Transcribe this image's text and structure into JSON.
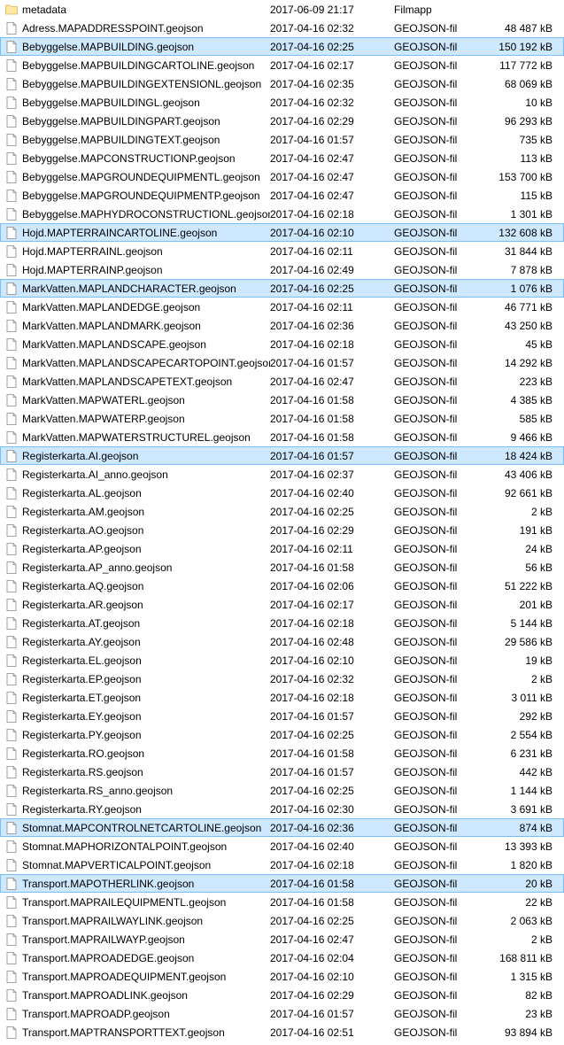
{
  "files": [
    {
      "name": "metadata",
      "date": "2017-06-09 21:17",
      "type": "Filmapp",
      "size": "",
      "icon": "folder",
      "selected": false
    },
    {
      "name": "Adress.MAPADDRESSPOINT.geojson",
      "date": "2017-04-16 02:32",
      "type": "GEOJSON-fil",
      "size": "48 487 kB",
      "icon": "file",
      "selected": false
    },
    {
      "name": "Bebyggelse.MAPBUILDING.geojson",
      "date": "2017-04-16 02:25",
      "type": "GEOJSON-fil",
      "size": "150 192 kB",
      "icon": "file",
      "selected": true
    },
    {
      "name": "Bebyggelse.MAPBUILDINGCARTOLINE.geojson",
      "date": "2017-04-16 02:17",
      "type": "GEOJSON-fil",
      "size": "117 772 kB",
      "icon": "file",
      "selected": false
    },
    {
      "name": "Bebyggelse.MAPBUILDINGEXTENSIONL.geojson",
      "date": "2017-04-16 02:35",
      "type": "GEOJSON-fil",
      "size": "68 069 kB",
      "icon": "file",
      "selected": false
    },
    {
      "name": "Bebyggelse.MAPBUILDINGL.geojson",
      "date": "2017-04-16 02:32",
      "type": "GEOJSON-fil",
      "size": "10 kB",
      "icon": "file",
      "selected": false
    },
    {
      "name": "Bebyggelse.MAPBUILDINGPART.geojson",
      "date": "2017-04-16 02:29",
      "type": "GEOJSON-fil",
      "size": "96 293 kB",
      "icon": "file",
      "selected": false
    },
    {
      "name": "Bebyggelse.MAPBUILDINGTEXT.geojson",
      "date": "2017-04-16 01:57",
      "type": "GEOJSON-fil",
      "size": "735 kB",
      "icon": "file",
      "selected": false
    },
    {
      "name": "Bebyggelse.MAPCONSTRUCTIONP.geojson",
      "date": "2017-04-16 02:47",
      "type": "GEOJSON-fil",
      "size": "113 kB",
      "icon": "file",
      "selected": false
    },
    {
      "name": "Bebyggelse.MAPGROUNDEQUIPMENTL.geojson",
      "date": "2017-04-16 02:47",
      "type": "GEOJSON-fil",
      "size": "153 700 kB",
      "icon": "file",
      "selected": false
    },
    {
      "name": "Bebyggelse.MAPGROUNDEQUIPMENTP.geojson",
      "date": "2017-04-16 02:47",
      "type": "GEOJSON-fil",
      "size": "115 kB",
      "icon": "file",
      "selected": false
    },
    {
      "name": "Bebyggelse.MAPHYDROCONSTRUCTIONL.geojson",
      "date": "2017-04-16 02:18",
      "type": "GEOJSON-fil",
      "size": "1 301 kB",
      "icon": "file",
      "selected": false
    },
    {
      "name": "Hojd.MAPTERRAINCARTOLINE.geojson",
      "date": "2017-04-16 02:10",
      "type": "GEOJSON-fil",
      "size": "132 608 kB",
      "icon": "file",
      "selected": true
    },
    {
      "name": "Hojd.MAPTERRAINL.geojson",
      "date": "2017-04-16 02:11",
      "type": "GEOJSON-fil",
      "size": "31 844 kB",
      "icon": "file",
      "selected": false
    },
    {
      "name": "Hojd.MAPTERRAINP.geojson",
      "date": "2017-04-16 02:49",
      "type": "GEOJSON-fil",
      "size": "7 878 kB",
      "icon": "file",
      "selected": false
    },
    {
      "name": "MarkVatten.MAPLANDCHARACTER.geojson",
      "date": "2017-04-16 02:25",
      "type": "GEOJSON-fil",
      "size": "1 076 kB",
      "icon": "file",
      "selected": true
    },
    {
      "name": "MarkVatten.MAPLANDEDGE.geojson",
      "date": "2017-04-16 02:11",
      "type": "GEOJSON-fil",
      "size": "46 771 kB",
      "icon": "file",
      "selected": false
    },
    {
      "name": "MarkVatten.MAPLANDMARK.geojson",
      "date": "2017-04-16 02:36",
      "type": "GEOJSON-fil",
      "size": "43 250 kB",
      "icon": "file",
      "selected": false
    },
    {
      "name": "MarkVatten.MAPLANDSCAPE.geojson",
      "date": "2017-04-16 02:18",
      "type": "GEOJSON-fil",
      "size": "45 kB",
      "icon": "file",
      "selected": false
    },
    {
      "name": "MarkVatten.MAPLANDSCAPECARTOPOINT.geojson",
      "date": "2017-04-16 01:57",
      "type": "GEOJSON-fil",
      "size": "14 292 kB",
      "icon": "file",
      "selected": false
    },
    {
      "name": "MarkVatten.MAPLANDSCAPETEXT.geojson",
      "date": "2017-04-16 02:47",
      "type": "GEOJSON-fil",
      "size": "223 kB",
      "icon": "file",
      "selected": false
    },
    {
      "name": "MarkVatten.MAPWATERL.geojson",
      "date": "2017-04-16 01:58",
      "type": "GEOJSON-fil",
      "size": "4 385 kB",
      "icon": "file",
      "selected": false
    },
    {
      "name": "MarkVatten.MAPWATERP.geojson",
      "date": "2017-04-16 01:58",
      "type": "GEOJSON-fil",
      "size": "585 kB",
      "icon": "file",
      "selected": false
    },
    {
      "name": "MarkVatten.MAPWATERSTRUCTUREL.geojson",
      "date": "2017-04-16 01:58",
      "type": "GEOJSON-fil",
      "size": "9 466 kB",
      "icon": "file",
      "selected": false
    },
    {
      "name": "Registerkarta.AI.geojson",
      "date": "2017-04-16 01:57",
      "type": "GEOJSON-fil",
      "size": "18 424 kB",
      "icon": "file",
      "selected": true
    },
    {
      "name": "Registerkarta.AI_anno.geojson",
      "date": "2017-04-16 02:37",
      "type": "GEOJSON-fil",
      "size": "43 406 kB",
      "icon": "file",
      "selected": false
    },
    {
      "name": "Registerkarta.AL.geojson",
      "date": "2017-04-16 02:40",
      "type": "GEOJSON-fil",
      "size": "92 661 kB",
      "icon": "file",
      "selected": false
    },
    {
      "name": "Registerkarta.AM.geojson",
      "date": "2017-04-16 02:25",
      "type": "GEOJSON-fil",
      "size": "2 kB",
      "icon": "file",
      "selected": false
    },
    {
      "name": "Registerkarta.AO.geojson",
      "date": "2017-04-16 02:29",
      "type": "GEOJSON-fil",
      "size": "191 kB",
      "icon": "file",
      "selected": false
    },
    {
      "name": "Registerkarta.AP.geojson",
      "date": "2017-04-16 02:11",
      "type": "GEOJSON-fil",
      "size": "24 kB",
      "icon": "file",
      "selected": false
    },
    {
      "name": "Registerkarta.AP_anno.geojson",
      "date": "2017-04-16 01:58",
      "type": "GEOJSON-fil",
      "size": "56 kB",
      "icon": "file",
      "selected": false
    },
    {
      "name": "Registerkarta.AQ.geojson",
      "date": "2017-04-16 02:06",
      "type": "GEOJSON-fil",
      "size": "51 222 kB",
      "icon": "file",
      "selected": false
    },
    {
      "name": "Registerkarta.AR.geojson",
      "date": "2017-04-16 02:17",
      "type": "GEOJSON-fil",
      "size": "201 kB",
      "icon": "file",
      "selected": false
    },
    {
      "name": "Registerkarta.AT.geojson",
      "date": "2017-04-16 02:18",
      "type": "GEOJSON-fil",
      "size": "5 144 kB",
      "icon": "file",
      "selected": false
    },
    {
      "name": "Registerkarta.AY.geojson",
      "date": "2017-04-16 02:48",
      "type": "GEOJSON-fil",
      "size": "29 586 kB",
      "icon": "file",
      "selected": false
    },
    {
      "name": "Registerkarta.EL.geojson",
      "date": "2017-04-16 02:10",
      "type": "GEOJSON-fil",
      "size": "19 kB",
      "icon": "file",
      "selected": false
    },
    {
      "name": "Registerkarta.EP.geojson",
      "date": "2017-04-16 02:32",
      "type": "GEOJSON-fil",
      "size": "2 kB",
      "icon": "file",
      "selected": false
    },
    {
      "name": "Registerkarta.ET.geojson",
      "date": "2017-04-16 02:18",
      "type": "GEOJSON-fil",
      "size": "3 011 kB",
      "icon": "file",
      "selected": false
    },
    {
      "name": "Registerkarta.EY.geojson",
      "date": "2017-04-16 01:57",
      "type": "GEOJSON-fil",
      "size": "292 kB",
      "icon": "file",
      "selected": false
    },
    {
      "name": "Registerkarta.PY.geojson",
      "date": "2017-04-16 02:25",
      "type": "GEOJSON-fil",
      "size": "2 554 kB",
      "icon": "file",
      "selected": false
    },
    {
      "name": "Registerkarta.RO.geojson",
      "date": "2017-04-16 01:58",
      "type": "GEOJSON-fil",
      "size": "6 231 kB",
      "icon": "file",
      "selected": false
    },
    {
      "name": "Registerkarta.RS.geojson",
      "date": "2017-04-16 01:57",
      "type": "GEOJSON-fil",
      "size": "442 kB",
      "icon": "file",
      "selected": false
    },
    {
      "name": "Registerkarta.RS_anno.geojson",
      "date": "2017-04-16 02:25",
      "type": "GEOJSON-fil",
      "size": "1 144 kB",
      "icon": "file",
      "selected": false
    },
    {
      "name": "Registerkarta.RY.geojson",
      "date": "2017-04-16 02:30",
      "type": "GEOJSON-fil",
      "size": "3 691 kB",
      "icon": "file",
      "selected": false
    },
    {
      "name": "Stomnat.MAPCONTROLNETCARTOLINE.geojson",
      "date": "2017-04-16 02:36",
      "type": "GEOJSON-fil",
      "size": "874 kB",
      "icon": "file",
      "selected": true
    },
    {
      "name": "Stomnat.MAPHORIZONTALPOINT.geojson",
      "date": "2017-04-16 02:40",
      "type": "GEOJSON-fil",
      "size": "13 393 kB",
      "icon": "file",
      "selected": false
    },
    {
      "name": "Stomnat.MAPVERTICALPOINT.geojson",
      "date": "2017-04-16 02:18",
      "type": "GEOJSON-fil",
      "size": "1 820 kB",
      "icon": "file",
      "selected": false
    },
    {
      "name": "Transport.MAPOTHERLINK.geojson",
      "date": "2017-04-16 01:58",
      "type": "GEOJSON-fil",
      "size": "20 kB",
      "icon": "file",
      "selected": true
    },
    {
      "name": "Transport.MAPRAILEQUIPMENTL.geojson",
      "date": "2017-04-16 01:58",
      "type": "GEOJSON-fil",
      "size": "22 kB",
      "icon": "file",
      "selected": false
    },
    {
      "name": "Transport.MAPRAILWAYLINK.geojson",
      "date": "2017-04-16 02:25",
      "type": "GEOJSON-fil",
      "size": "2 063 kB",
      "icon": "file",
      "selected": false
    },
    {
      "name": "Transport.MAPRAILWAYP.geojson",
      "date": "2017-04-16 02:47",
      "type": "GEOJSON-fil",
      "size": "2 kB",
      "icon": "file",
      "selected": false
    },
    {
      "name": "Transport.MAPROADEDGE.geojson",
      "date": "2017-04-16 02:04",
      "type": "GEOJSON-fil",
      "size": "168 811 kB",
      "icon": "file",
      "selected": false
    },
    {
      "name": "Transport.MAPROADEQUIPMENT.geojson",
      "date": "2017-04-16 02:10",
      "type": "GEOJSON-fil",
      "size": "1 315 kB",
      "icon": "file",
      "selected": false
    },
    {
      "name": "Transport.MAPROADLINK.geojson",
      "date": "2017-04-16 02:29",
      "type": "GEOJSON-fil",
      "size": "82 kB",
      "icon": "file",
      "selected": false
    },
    {
      "name": "Transport.MAPROADP.geojson",
      "date": "2017-04-16 01:57",
      "type": "GEOJSON-fil",
      "size": "23 kB",
      "icon": "file",
      "selected": false
    },
    {
      "name": "Transport.MAPTRANSPORTTEXT.geojson",
      "date": "2017-04-16 02:51",
      "type": "GEOJSON-fil",
      "size": "93 894 kB",
      "icon": "file",
      "selected": false
    }
  ]
}
